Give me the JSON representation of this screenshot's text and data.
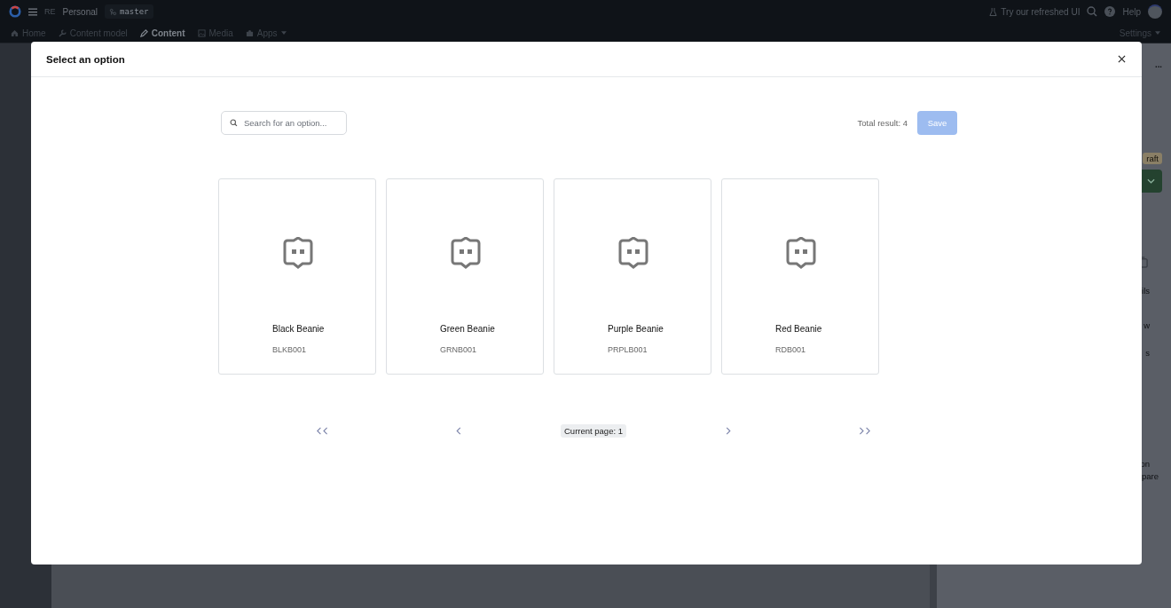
{
  "topbar": {
    "workspace_initials": "RE",
    "workspace": "Personal",
    "environment": "master",
    "refresh_link": "Try our refreshed UI",
    "help": "Help"
  },
  "nav": {
    "items": [
      {
        "label": "Home",
        "kind": "link",
        "selected": false
      },
      {
        "label": "Content model",
        "kind": "link",
        "selected": false
      },
      {
        "label": "Content",
        "kind": "link",
        "selected": true
      },
      {
        "label": "Media",
        "kind": "link",
        "selected": false
      },
      {
        "label": "Apps",
        "kind": "dropdown",
        "selected": false
      }
    ],
    "settings": "Settings"
  },
  "side_panel": {
    "menu": "...",
    "status": "raft",
    "fragments": [
      "ils",
      "w",
      "s",
      "on",
      "pare"
    ]
  },
  "modal": {
    "title": "Select an option",
    "search": {
      "placeholder": "Search for an option..."
    },
    "total": "Total result: 4",
    "save": {
      "label": "Save",
      "disabled": true
    },
    "options": [
      {
        "name": "Black Beanie",
        "sku": "BLKB001"
      },
      {
        "name": "Green Beanie",
        "sku": "GRNB001"
      },
      {
        "name": "Purple Beanie",
        "sku": "PRPLB001"
      },
      {
        "name": "Red Beanie",
        "sku": "RDB001"
      }
    ],
    "pagination": {
      "current": "Current page: 1"
    }
  }
}
